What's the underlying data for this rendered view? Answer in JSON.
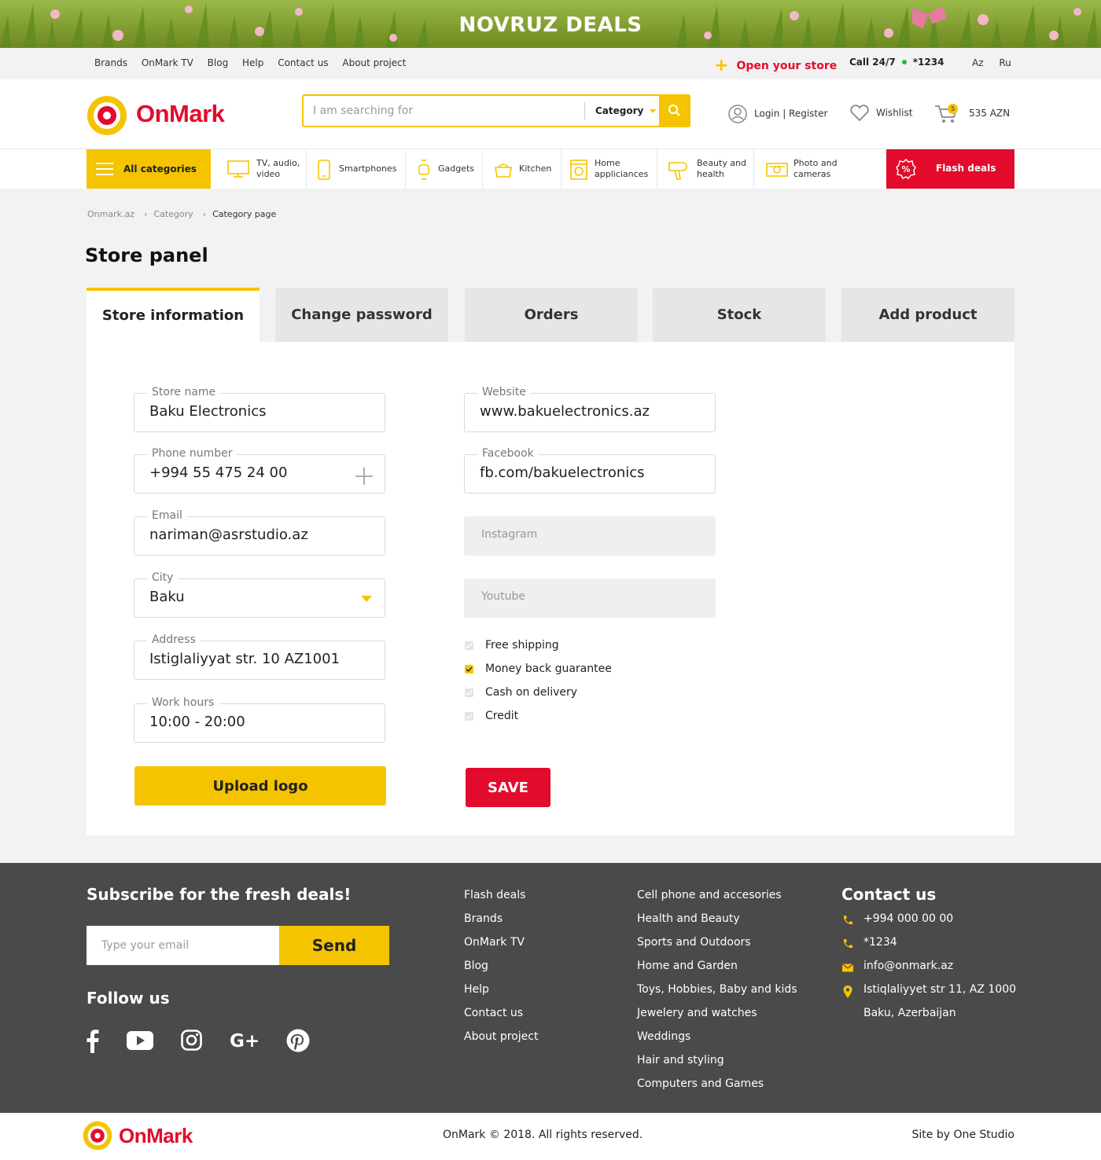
{
  "banner": {
    "title": "NOVRUZ DEALS"
  },
  "topbar": {
    "links": [
      "Brands",
      "OnMark TV",
      "Blog",
      "Help",
      "Contact us",
      "About project"
    ],
    "open_store": "Open your store",
    "call_label": "Call 24/7",
    "call_number": "*1234",
    "languages": [
      "Az",
      "Ru"
    ]
  },
  "header": {
    "logo_text": "OnMark",
    "search_placeholder": "I am searching for",
    "category_label": "Category",
    "login_label": "Login | Register",
    "wishlist_label": "Wishlist",
    "cart_count": "5",
    "cart_amount": "535 AZN"
  },
  "catbar": {
    "all_categories": "All categories",
    "items": [
      "TV, audio, video",
      "Smartphones",
      "Gadgets",
      "Kitchen",
      "Home appliciances",
      "Beauty and health",
      "Photo and cameras"
    ],
    "flash_deals": "Flash deals"
  },
  "breadcrumb": [
    "Onmark.az",
    "Category",
    "Category page"
  ],
  "page_title": "Store panel",
  "tabs": [
    "Store information",
    "Change password",
    "Orders",
    "Stock",
    "Add product"
  ],
  "form": {
    "store_name": {
      "label": "Store name",
      "value": "Baku Electronics"
    },
    "phone": {
      "label": "Phone number",
      "value": "+994 55 475 24 00"
    },
    "email": {
      "label": "Email",
      "value": "nariman@asrstudio.az"
    },
    "city": {
      "label": "City",
      "value": "Baku"
    },
    "address": {
      "label": "Address",
      "value": "Istiglaliyyat str. 10 AZ1001"
    },
    "work_hours": {
      "label": "Work hours",
      "value": "10:00 - 20:00"
    },
    "website": {
      "label": "Website",
      "value": "www.bakuelectronics.az"
    },
    "facebook": {
      "label": "Facebook",
      "value": "fb.com/bakuelectronics"
    },
    "instagram": {
      "placeholder": "Instagram"
    },
    "youtube": {
      "placeholder": "Youtube"
    },
    "options": [
      {
        "label": "Free shipping",
        "checked": false
      },
      {
        "label": "Money back guarantee",
        "checked": true
      },
      {
        "label": "Cash on delivery",
        "checked": false
      },
      {
        "label": "Credit",
        "checked": false
      }
    ],
    "upload_logo": "Upload logo",
    "save": "SAVE"
  },
  "footer": {
    "subscribe_title": "Subscribe for the fresh deals!",
    "email_placeholder": "Type your email",
    "send": "Send",
    "follow_title": "Follow us",
    "social_icons": [
      "facebook-icon",
      "youtube-icon",
      "instagram-icon",
      "google-plus-icon",
      "pinterest-icon"
    ],
    "col1": [
      "Flash deals",
      "Brands",
      "OnMark TV",
      "Blog",
      "Help",
      "Contact us",
      "About project"
    ],
    "col2": [
      "Cell phone and accesories",
      "Health and Beauty",
      "Sports and Outdoors",
      "Home and Garden",
      "Toys, Hobbies, Baby and kids",
      "Jewelery and watches",
      "Weddings",
      "Hair and styling",
      "Computers and Games"
    ],
    "contact_title": "Contact us",
    "phone1": "+994 000 00 00",
    "phone2": "*1234",
    "email": "info@onmark.az",
    "address1": "Istiqlaliyyet str 11, AZ 1000",
    "address2": "Baku, Azerbaijan"
  },
  "bottom": {
    "logo_text": "OnMark",
    "copyright": "OnMark © 2018. All rights reserved.",
    "site_by": "Site by One Studio"
  },
  "colors": {
    "accent_yellow": "#f5c400",
    "brand_red": "#e30b2c",
    "footer_bg": "#4a4a4a"
  }
}
